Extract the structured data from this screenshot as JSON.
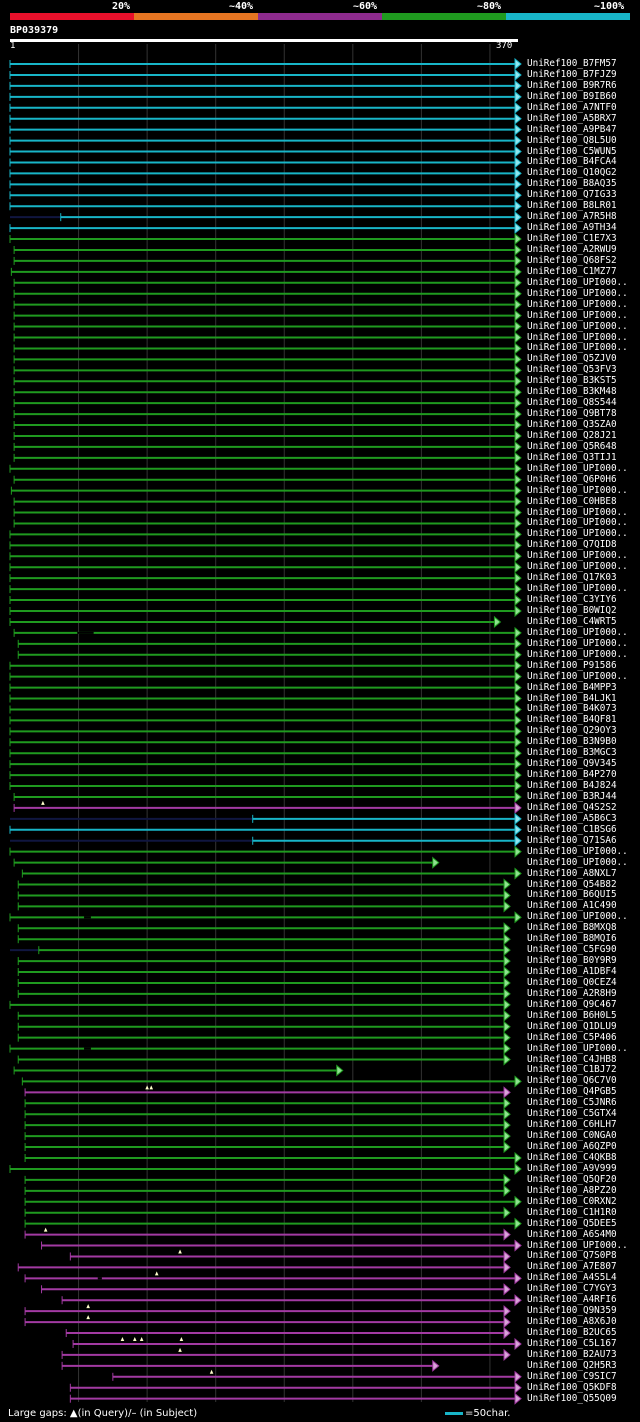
{
  "legend": [
    {
      "label": "20%",
      "color": "#e8102b"
    },
    {
      "label": "~40%",
      "color": "#e57522"
    },
    {
      "label": "~60%",
      "color": "#8e2b8e"
    },
    {
      "label": "~80%",
      "color": "#1f9a1f"
    },
    {
      "label": "~100%",
      "color": "#18b5c8"
    }
  ],
  "query": {
    "name": "BP039379",
    "start": "1",
    "end": "370"
  },
  "footer": {
    "gaps_text": "Large gaps: ▲(in Query)/– (in Subject)",
    "scale_text": "=50char."
  },
  "colors": {
    "cyan": "#18b5c8",
    "green": "#1f9a1f",
    "purple": "#a23aa2",
    "gap": "#ffffcc",
    "ghost": "#101640"
  },
  "hits": [
    {
      "label": "UniRef100_B7FM57",
      "c": "cyan",
      "s": 1,
      "e": 370
    },
    {
      "label": "UniRef100_B7FJZ9",
      "c": "cyan",
      "s": 1,
      "e": 370
    },
    {
      "label": "UniRef100_B9R7R6",
      "c": "cyan",
      "s": 1,
      "e": 370
    },
    {
      "label": "UniRef100_B9IB60",
      "c": "cyan",
      "s": 1,
      "e": 370
    },
    {
      "label": "UniRef100_A7NTF0",
      "c": "cyan",
      "s": 1,
      "e": 370
    },
    {
      "label": "UniRef100_A5BRX7",
      "c": "cyan",
      "s": 1,
      "e": 370
    },
    {
      "label": "UniRef100_A9PB47",
      "c": "cyan",
      "s": 1,
      "e": 370
    },
    {
      "label": "UniRef100_Q8L5U0",
      "c": "cyan",
      "s": 1,
      "e": 370
    },
    {
      "label": "UniRef100_C5WUN5",
      "c": "cyan",
      "s": 1,
      "e": 370
    },
    {
      "label": "UniRef100_B4FCA4",
      "c": "cyan",
      "s": 1,
      "e": 370
    },
    {
      "label": "UniRef100_Q10QG2",
      "c": "cyan",
      "s": 1,
      "e": 370
    },
    {
      "label": "UniRef100_B8AQ35",
      "c": "cyan",
      "s": 1,
      "e": 370
    },
    {
      "label": "UniRef100_Q7IG33",
      "c": "cyan",
      "s": 1,
      "e": 370
    },
    {
      "label": "UniRef100_B8LR01",
      "c": "cyan",
      "s": 1,
      "e": 370
    },
    {
      "label": "UniRef100_A7R5H8",
      "c": "cyan",
      "s": 38,
      "e": 370,
      "ghost": 1
    },
    {
      "label": "UniRef100_A9TH34",
      "c": "cyan",
      "s": 1,
      "e": 370
    },
    {
      "label": "UniRef100_C1E7X3",
      "c": "green",
      "s": 1,
      "e": 370
    },
    {
      "label": "UniRef100_A2RWU9",
      "c": "green",
      "s": 4,
      "e": 370
    },
    {
      "label": "UniRef100_Q68FS2",
      "c": "green",
      "s": 4,
      "e": 370
    },
    {
      "label": "UniRef100_C1MZ77",
      "c": "green",
      "s": 2,
      "e": 370
    },
    {
      "label": "UniRef100_UPI000..",
      "c": "green",
      "s": 4,
      "e": 370
    },
    {
      "label": "UniRef100_UPI000..",
      "c": "green",
      "s": 4,
      "e": 370
    },
    {
      "label": "UniRef100_UPI000..",
      "c": "green",
      "s": 4,
      "e": 370
    },
    {
      "label": "UniRef100_UPI000..",
      "c": "green",
      "s": 4,
      "e": 370
    },
    {
      "label": "UniRef100_UPI000..",
      "c": "green",
      "s": 4,
      "e": 370
    },
    {
      "label": "UniRef100_UPI000..",
      "c": "green",
      "s": 4,
      "e": 370
    },
    {
      "label": "UniRef100_UPI000..",
      "c": "green",
      "s": 4,
      "e": 370
    },
    {
      "label": "UniRef100_Q5ZJV0",
      "c": "green",
      "s": 4,
      "e": 370
    },
    {
      "label": "UniRef100_Q53FV3",
      "c": "green",
      "s": 4,
      "e": 370
    },
    {
      "label": "UniRef100_B3KST5",
      "c": "green",
      "s": 4,
      "e": 370
    },
    {
      "label": "UniRef100_B3KM48",
      "c": "green",
      "s": 4,
      "e": 370
    },
    {
      "label": "UniRef100_Q8S544",
      "c": "green",
      "s": 4,
      "e": 370
    },
    {
      "label": "UniRef100_Q9BT78",
      "c": "green",
      "s": 4,
      "e": 370
    },
    {
      "label": "UniRef100_Q3SZA0",
      "c": "green",
      "s": 4,
      "e": 370
    },
    {
      "label": "UniRef100_Q28J21",
      "c": "green",
      "s": 4,
      "e": 370
    },
    {
      "label": "UniRef100_Q5R648",
      "c": "green",
      "s": 4,
      "e": 370
    },
    {
      "label": "UniRef100_Q3TIJ1",
      "c": "green",
      "s": 4,
      "e": 370
    },
    {
      "label": "UniRef100_UPI000..",
      "c": "green",
      "s": 1,
      "e": 370
    },
    {
      "label": "UniRef100_Q6P0H6",
      "c": "green",
      "s": 4,
      "e": 370
    },
    {
      "label": "UniRef100_UPI000..",
      "c": "green",
      "s": 2,
      "e": 370
    },
    {
      "label": "UniRef100_C0HBE8",
      "c": "green",
      "s": 4,
      "e": 370
    },
    {
      "label": "UniRef100_UPI000..",
      "c": "green",
      "s": 4,
      "e": 370
    },
    {
      "label": "UniRef100_UPI000..",
      "c": "green",
      "s": 4,
      "e": 370
    },
    {
      "label": "UniRef100_UPI000..",
      "c": "green",
      "s": 1,
      "e": 370
    },
    {
      "label": "UniRef100_Q7QID8",
      "c": "green",
      "s": 1,
      "e": 370
    },
    {
      "label": "UniRef100_UPI000..",
      "c": "green",
      "s": 1,
      "e": 370
    },
    {
      "label": "UniRef100_UPI000..",
      "c": "green",
      "s": 1,
      "e": 370
    },
    {
      "label": "UniRef100_Q17K03",
      "c": "green",
      "s": 1,
      "e": 370
    },
    {
      "label": "UniRef100_UPI000..",
      "c": "green",
      "s": 1,
      "e": 370
    },
    {
      "label": "UniRef100_C3YIY6",
      "c": "green",
      "s": 1,
      "e": 370
    },
    {
      "label": "UniRef100_B0WIQ2",
      "c": "green",
      "s": 1,
      "e": 370
    },
    {
      "label": "UniRef100_C4WRT5",
      "c": "green",
      "s": 1,
      "e": 355
    },
    {
      "label": "UniRef100_UPI000..",
      "c": "green",
      "s": 4,
      "e": 370,
      "sgap": [
        50,
        62
      ]
    },
    {
      "label": "UniRef100_UPI000..",
      "c": "green",
      "s": 7,
      "e": 370
    },
    {
      "label": "UniRef100_UPI000..",
      "c": "green",
      "s": 7,
      "e": 370
    },
    {
      "label": "UniRef100_P91586",
      "c": "green",
      "s": 1,
      "e": 370
    },
    {
      "label": "UniRef100_UPI000..",
      "c": "green",
      "s": 1,
      "e": 370
    },
    {
      "label": "UniRef100_B4MPP3",
      "c": "green",
      "s": 1,
      "e": 370
    },
    {
      "label": "UniRef100_B4LJK1",
      "c": "green",
      "s": 1,
      "e": 370
    },
    {
      "label": "UniRef100_B4K073",
      "c": "green",
      "s": 1,
      "e": 370
    },
    {
      "label": "UniRef100_B4QF81",
      "c": "green",
      "s": 1,
      "e": 370
    },
    {
      "label": "UniRef100_Q29OY3",
      "c": "green",
      "s": 1,
      "e": 370
    },
    {
      "label": "UniRef100_B3N9B0",
      "c": "green",
      "s": 1,
      "e": 370
    },
    {
      "label": "UniRef100_B3MGC3",
      "c": "green",
      "s": 1,
      "e": 370
    },
    {
      "label": "UniRef100_Q9V345",
      "c": "green",
      "s": 1,
      "e": 370
    },
    {
      "label": "UniRef100_B4P270",
      "c": "green",
      "s": 1,
      "e": 370
    },
    {
      "label": "UniRef100_B4J824",
      "c": "green",
      "s": 1,
      "e": 370
    },
    {
      "label": "UniRef100_B3RJ44",
      "c": "green",
      "s": 4,
      "e": 370
    },
    {
      "label": "UniRef100_Q4S2S2",
      "c": "purple",
      "s": 4,
      "e": 370,
      "qgap": [
        25
      ]
    },
    {
      "label": "UniRef100_A5B6C3",
      "c": "cyan",
      "s": 178,
      "e": 370,
      "ghost": 1
    },
    {
      "label": "UniRef100_C1BSG6",
      "c": "cyan",
      "s": 1,
      "e": 370
    },
    {
      "label": "UniRef100_Q71SA6",
      "c": "cyan",
      "s": 178,
      "e": 370,
      "ghost": 1
    },
    {
      "label": "UniRef100_UPI000..",
      "c": "green",
      "s": 1,
      "e": 370
    },
    {
      "label": "UniRef100_UPI000..",
      "c": "green",
      "s": 4,
      "e": 310
    },
    {
      "label": "UniRef100_A8NXL7",
      "c": "green",
      "s": 10,
      "e": 370
    },
    {
      "label": "UniRef100_Q54B82",
      "c": "green",
      "s": 7,
      "e": 362
    },
    {
      "label": "UniRef100_B6QUI5",
      "c": "green",
      "s": 7,
      "e": 362
    },
    {
      "label": "UniRef100_A1C490",
      "c": "green",
      "s": 7,
      "e": 362
    },
    {
      "label": "UniRef100_UPI000..",
      "c": "green",
      "s": 1,
      "e": 370,
      "sgap": [
        55,
        60
      ]
    },
    {
      "label": "UniRef100_B8MXQ8",
      "c": "green",
      "s": 7,
      "e": 362
    },
    {
      "label": "UniRef100_B8MQI6",
      "c": "green",
      "s": 7,
      "e": 362
    },
    {
      "label": "UniRef100_C5FG90",
      "c": "green",
      "s": 22,
      "e": 362,
      "ghost": 1
    },
    {
      "label": "UniRef100_B0Y9R9",
      "c": "green",
      "s": 7,
      "e": 362
    },
    {
      "label": "UniRef100_A1DBF4",
      "c": "green",
      "s": 7,
      "e": 362
    },
    {
      "label": "UniRef100_Q0CEZ4",
      "c": "green",
      "s": 7,
      "e": 362
    },
    {
      "label": "UniRef100_A2R8H9",
      "c": "green",
      "s": 7,
      "e": 362
    },
    {
      "label": "UniRef100_Q9C467",
      "c": "green",
      "s": 1,
      "e": 362
    },
    {
      "label": "UniRef100_B6H0L5",
      "c": "green",
      "s": 7,
      "e": 362
    },
    {
      "label": "UniRef100_Q1DLU9",
      "c": "green",
      "s": 7,
      "e": 362
    },
    {
      "label": "UniRef100_C5P406",
      "c": "green",
      "s": 7,
      "e": 362
    },
    {
      "label": "UniRef100_UPI000..",
      "c": "green",
      "s": 1,
      "e": 362,
      "sgap": [
        55,
        60
      ]
    },
    {
      "label": "UniRef100_C4JHB8",
      "c": "green",
      "s": 7,
      "e": 362
    },
    {
      "label": "UniRef100_C1BJ72",
      "c": "green",
      "s": 4,
      "e": 240
    },
    {
      "label": "UniRef100_Q6C7V0",
      "c": "green",
      "s": 10,
      "e": 370
    },
    {
      "label": "UniRef100_Q4PGB5",
      "c": "purple",
      "s": 12,
      "e": 362,
      "qgap": [
        101,
        104
      ]
    },
    {
      "label": "UniRef100_C5JNR6",
      "c": "green",
      "s": 12,
      "e": 362
    },
    {
      "label": "UniRef100_C5GTX4",
      "c": "green",
      "s": 12,
      "e": 362
    },
    {
      "label": "UniRef100_C6HLH7",
      "c": "green",
      "s": 12,
      "e": 362
    },
    {
      "label": "UniRef100_C0NGA0",
      "c": "green",
      "s": 12,
      "e": 362
    },
    {
      "label": "UniRef100_A6QZP0",
      "c": "green",
      "s": 12,
      "e": 362
    },
    {
      "label": "UniRef100_C4QKB8",
      "c": "green",
      "s": 12,
      "e": 370
    },
    {
      "label": "UniRef100_A9V999",
      "c": "green",
      "s": 1,
      "e": 370
    },
    {
      "label": "UniRef100_Q5QF20",
      "c": "green",
      "s": 12,
      "e": 362
    },
    {
      "label": "UniRef100_A8PZ20",
      "c": "green",
      "s": 12,
      "e": 362
    },
    {
      "label": "UniRef100_C0RXN2",
      "c": "green",
      "s": 12,
      "e": 370
    },
    {
      "label": "UniRef100_C1H1R0",
      "c": "green",
      "s": 12,
      "e": 362
    },
    {
      "label": "UniRef100_Q5DEE5",
      "c": "green",
      "s": 12,
      "e": 370
    },
    {
      "label": "UniRef100_A6S4M0",
      "c": "purple",
      "s": 12,
      "e": 362,
      "qgap": [
        27
      ]
    },
    {
      "label": "UniRef100_UPI000..",
      "c": "purple",
      "s": 24,
      "e": 370
    },
    {
      "label": "UniRef100_Q7S0P8",
      "c": "purple",
      "s": 45,
      "e": 362,
      "qgap": [
        125
      ]
    },
    {
      "label": "UniRef100_A7E807",
      "c": "purple",
      "s": 7,
      "e": 362
    },
    {
      "label": "UniRef100_A4S5L4",
      "c": "purple",
      "s": 12,
      "e": 370,
      "qgap": [
        108
      ],
      "sgap": [
        65,
        68
      ]
    },
    {
      "label": "UniRef100_C7YGY3",
      "c": "purple",
      "s": 24,
      "e": 362
    },
    {
      "label": "UniRef100_A4RFI6",
      "c": "purple",
      "s": 39,
      "e": 370
    },
    {
      "label": "UniRef100_Q9N359",
      "c": "purple",
      "s": 12,
      "e": 362,
      "qgap": [
        58
      ]
    },
    {
      "label": "UniRef100_A8X6J0",
      "c": "purple",
      "s": 12,
      "e": 362,
      "qgap": [
        58
      ]
    },
    {
      "label": "UniRef100_B2UC65",
      "c": "purple",
      "s": 42,
      "e": 362
    },
    {
      "label": "UniRef100_C5L167",
      "c": "purple",
      "s": 47,
      "e": 370,
      "qgap": [
        83,
        92,
        97,
        126
      ]
    },
    {
      "label": "UniRef100_B2AU73",
      "c": "purple",
      "s": 39,
      "e": 362,
      "qgap": [
        125
      ]
    },
    {
      "label": "UniRef100_Q2H5R3",
      "c": "purple",
      "s": 39,
      "e": 310
    },
    {
      "label": "UniRef100_C9SIC7",
      "c": "purple",
      "s": 76,
      "e": 370,
      "qgap": [
        148
      ]
    },
    {
      "label": "UniRef100_Q5KDF8",
      "c": "purple",
      "s": 45,
      "e": 370
    },
    {
      "label": "UniRef100_Q55Q09",
      "c": "purple",
      "s": 45,
      "e": 370
    }
  ]
}
